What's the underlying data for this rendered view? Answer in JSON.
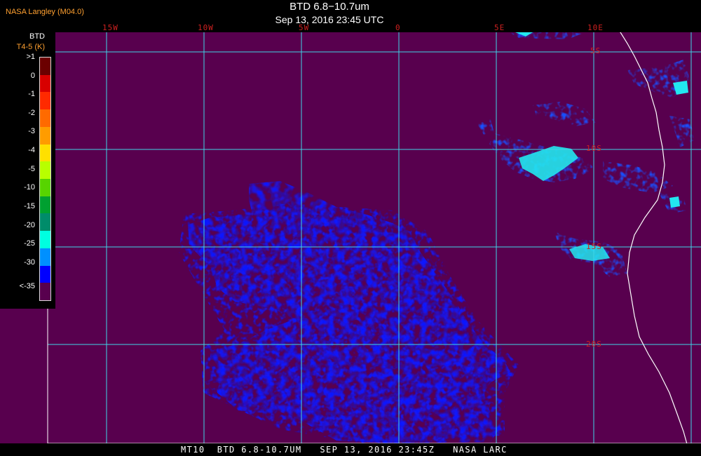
{
  "header": {
    "credit": "NASA Langley (M04.0)",
    "title": "BTD 6.8−10.7um",
    "subtitle": "Sep 13, 2016 23:45 UTC"
  },
  "map": {
    "background_color": "#58004e",
    "grid_color": "#3fd6e6",
    "coast_color": "#ffffff",
    "longitude_labels": [
      "15W",
      "10W",
      "5W",
      "0",
      "5E",
      "10E"
    ],
    "latitude_labels": [
      "5S",
      "10S",
      "15S",
      "20S"
    ]
  },
  "legend": {
    "quantity": "BTD",
    "unit": "T4-5 (K)",
    "ticks": [
      ">1",
      "0",
      "-1",
      "-2",
      "-3",
      "-4",
      "-5",
      "-10",
      "-15",
      "-20",
      "-25",
      "-30",
      "<-35"
    ],
    "colors": [
      "#6b0000",
      "#d80000",
      "#ff2a00",
      "#ff6a00",
      "#ff9c00",
      "#ffe000",
      "#b8ff00",
      "#57d400",
      "#00a030",
      "#008c6a",
      "#00ffe0",
      "#0090ff",
      "#0000ff",
      "#58004e"
    ]
  },
  "footer": {
    "text": "MT10  BTD 6.8-10.7UM   SEP 13, 2016 23:45Z   NASA LARC"
  }
}
